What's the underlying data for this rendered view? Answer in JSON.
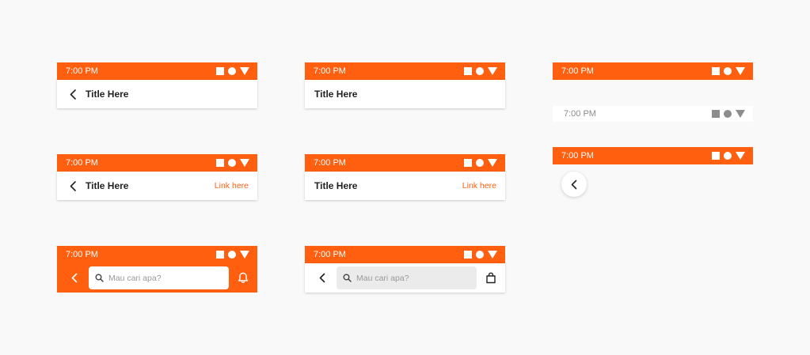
{
  "status_time": "7:00 PM",
  "icons": {
    "status": [
      "square-icon",
      "circle-icon",
      "triangle-icon"
    ],
    "back": "chevron-left-icon",
    "search": "search-icon",
    "notification": "bell-icon",
    "cart": "shopping-bag-icon"
  },
  "colors": {
    "primary": "#ff5f0f",
    "background": "#f9f9f9",
    "text": "#222222",
    "placeholder": "#999999",
    "light_status_text": "#8c8c8c"
  },
  "variants": {
    "back_title": {
      "time": "7:00 PM",
      "title": "Title Here"
    },
    "title_only": {
      "time": "7:00 PM",
      "title": "Title Here"
    },
    "back_title_link": {
      "time": "7:00 PM",
      "title": "Title Here",
      "link": "Link here"
    },
    "title_link": {
      "time": "7:00 PM",
      "title": "Title Here",
      "link": "Link here"
    },
    "search_orange": {
      "time": "7:00 PM",
      "placeholder": "Mau cari apa?"
    },
    "search_white": {
      "time": "7:00 PM",
      "placeholder": "Mau cari apa?"
    },
    "status_orange_only": {
      "time": "7:00 PM"
    },
    "status_light_only": {
      "time": "7:00 PM"
    },
    "status_floating_back": {
      "time": "7:00 PM"
    }
  }
}
